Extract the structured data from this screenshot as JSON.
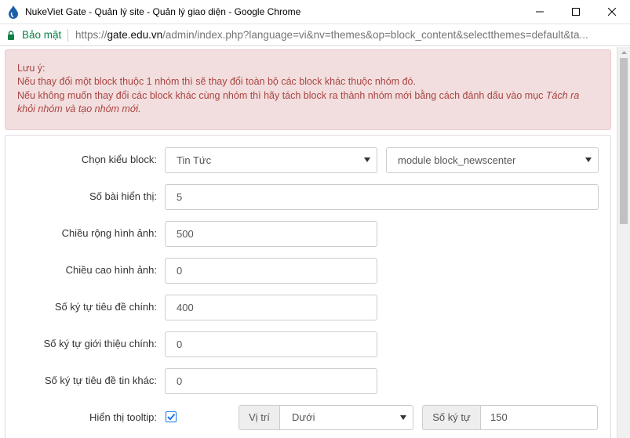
{
  "window": {
    "title": "NukeViet Gate - Quản lý site - Quản lý giao diện - Google Chrome"
  },
  "address_bar": {
    "secure_label": "Bảo mật",
    "url_scheme": "https://",
    "url_host": "gate.edu.vn",
    "url_rest": "/admin/index.php?language=vi&nv=themes&op=block_content&selectthemes=default&ta..."
  },
  "alert": {
    "heading": "Lưu ý:",
    "line1": "Nếu thay đổi một block thuộc 1 nhóm thì sẽ thay đổi toàn bộ các block khác thuộc nhóm đó.",
    "line2": "Nếu không muốn thay đổi các block khác cùng nhóm thì hãy tách block ra thành nhóm mới bằng cách đánh dấu vào mục ",
    "line2_emphasis": "Tách ra khỏi nhóm và tạo nhóm mới."
  },
  "form": {
    "block_type": {
      "label": "Chọn kiểu block:",
      "module_value": "Tin Tức",
      "block_value": "module block_newscenter"
    },
    "num_articles": {
      "label": "Số bài hiển thị:",
      "value": "5"
    },
    "image_width": {
      "label": "Chiều rộng hình ảnh:",
      "value": "500"
    },
    "image_height": {
      "label": "Chiều cao hình ảnh:",
      "value": "0"
    },
    "main_title_chars": {
      "label": "Số ký tự tiêu đề chính:",
      "value": "400"
    },
    "main_intro_chars": {
      "label": "Số ký tự giới thiệu chính:",
      "value": "0"
    },
    "other_title_chars": {
      "label": "Số ký tự tiêu đề tin khác:",
      "value": "0"
    },
    "tooltip": {
      "label": "Hiển thị tooltip:",
      "checked": true,
      "position_label": "Vị trí",
      "position_value": "Dưới",
      "chars_label": "Số ký tự",
      "chars_value": "150"
    }
  },
  "colors": {
    "alert_bg": "#f2dede",
    "alert_text": "#a94442",
    "secure_green": "#0b8043",
    "checkbox_blue": "#1a73e8"
  },
  "icons": {
    "app": "nukeviet-drop-icon",
    "lock": "lock-icon",
    "minimize": "minimize-icon",
    "maximize": "maximize-icon",
    "close": "close-icon",
    "select_arrow": "caret-down-icon",
    "check": "check-icon"
  }
}
